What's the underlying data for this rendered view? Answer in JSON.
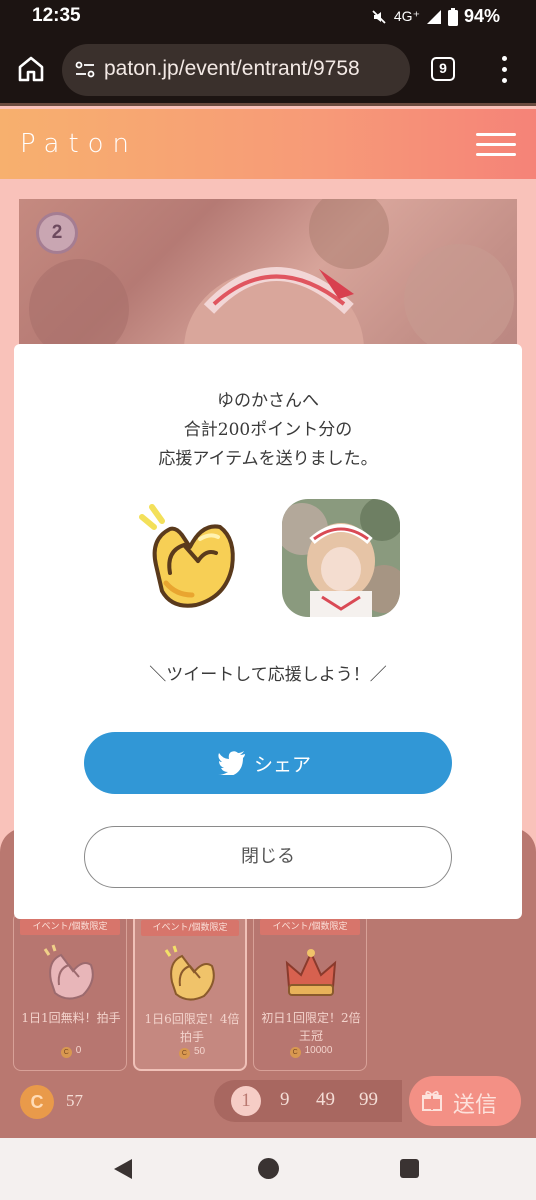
{
  "status_bar": {
    "time": "12:35",
    "network": "4G⁺",
    "battery": "94%"
  },
  "browser": {
    "url": "paton.jp/event/entrant/9758",
    "tab_count": "9"
  },
  "site": {
    "logo": "Paton"
  },
  "entrant": {
    "rank": "2"
  },
  "modal": {
    "message_line1": "ゆのかさんへ",
    "message_line2": "合計200ポイント分の",
    "message_line3": "応援アイテムを送りました。",
    "cta": "＼ツイートして応援しよう！／",
    "share_label": "シェア",
    "close_label": "閉じる"
  },
  "items": [
    {
      "tag": "イベント/個数限定",
      "name": "1日1回無料！拍手",
      "price": "0",
      "icon": "clap-icon"
    },
    {
      "tag": "イベント/個数限定",
      "name": "1日6回限定！4倍拍手",
      "price": "50",
      "icon": "golden-clap-icon"
    },
    {
      "tag": "イベント/個数限定",
      "name": "初日1回限定！2倍王冠",
      "price": "10000",
      "icon": "crown-icon"
    }
  ],
  "wallet": {
    "coin_symbol": "C",
    "coins": "57"
  },
  "quantities": [
    "1",
    "9",
    "49",
    "99"
  ],
  "selected_quantity": "1",
  "send_label": "送信",
  "colors": {
    "header_start": "#f7b06e",
    "header_end": "#f58378",
    "share": "#3197d6",
    "send": "#f39085"
  }
}
